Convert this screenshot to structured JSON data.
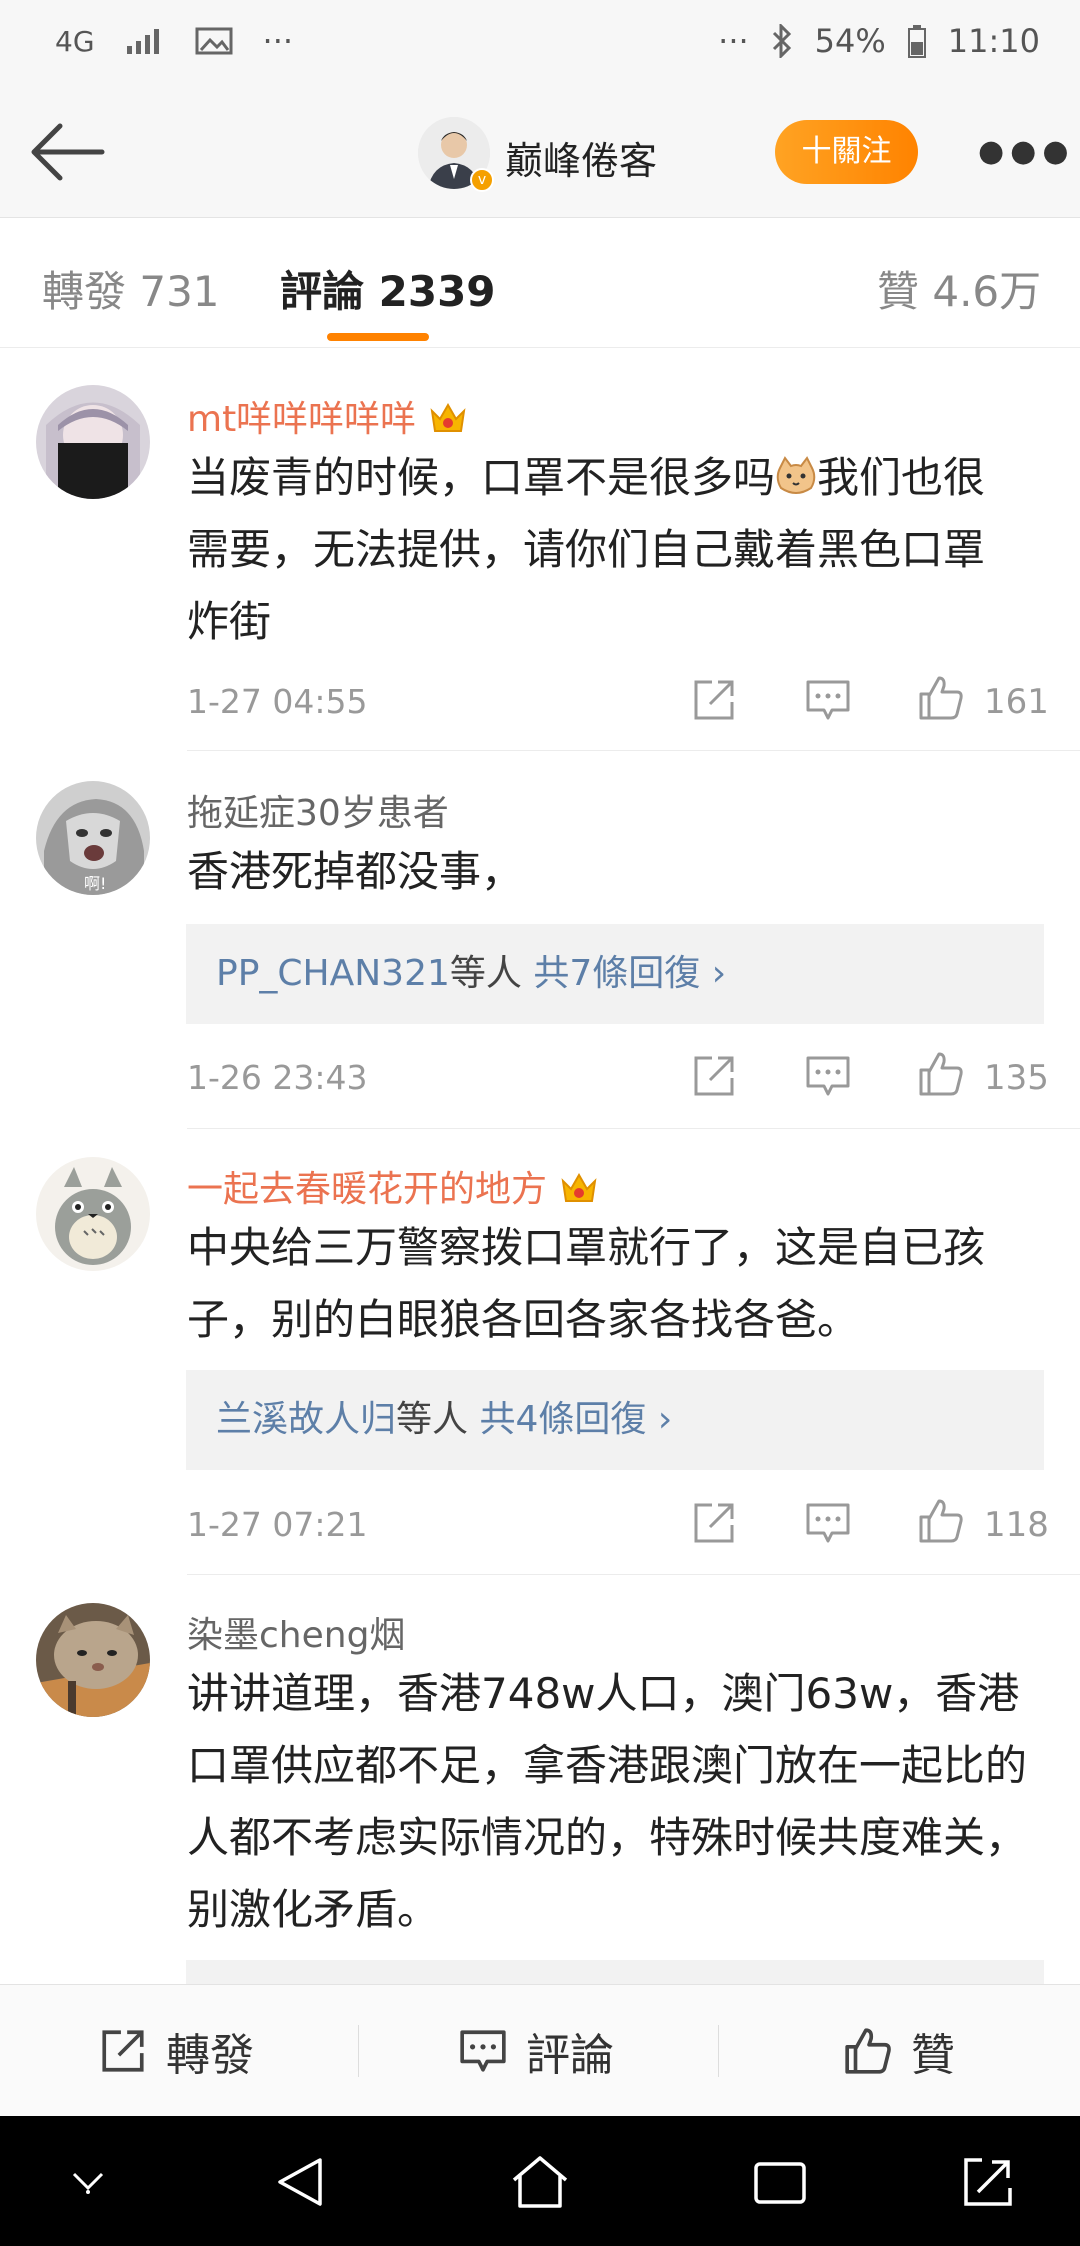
{
  "status": {
    "network": "4G",
    "battery": "54%",
    "time": "11:10"
  },
  "header": {
    "name": "巅峰倦客",
    "follow": "十關注"
  },
  "tabs": {
    "repost": "轉發 731",
    "comments": "評論 2339",
    "likes": "贊 4.6万"
  },
  "comments": [
    {
      "name": "mt咩咩咩咩咩",
      "vip": true,
      "lines": [
        "当废青的时候，口罩不是很多吗",
        "我们也很",
        "需要，无法提供，请你们自己戴着黑色口罩",
        "炸街"
      ],
      "time": "1-27 04:55",
      "likes": "161"
    },
    {
      "name": "拖延症30岁患者",
      "vip": false,
      "text": "香港死掉都没事，",
      "reply_user": "PP_CHAN321",
      "reply_mid": "等人",
      "reply_count": "共7條回復 ›",
      "time": "1-26 23:43",
      "likes": "135"
    },
    {
      "name": "一起去春暖花开的地方",
      "vip": true,
      "text": "中央给三万警察拨口罩就行了，这是自已孩子，别的白眼狼各回各家各找各爸。",
      "reply_user": "兰溪故人归",
      "reply_mid": "等人",
      "reply_count": "共4條回復 ›",
      "time": "1-27 07:21",
      "likes": "118"
    },
    {
      "name": "染墨cheng烟",
      "vip": false,
      "text": "讲讲道理，香港748w人口，澳门63w，香港口罩供应都不足，拿香港跟澳门放在一起比的人都不考虑实际情况的，特殊时候共度难关，别激化矛盾。"
    }
  ],
  "bottom": {
    "repost": "轉發",
    "comment": "評論",
    "like": "贊"
  },
  "icons": [
    "back-icon",
    "share-icon",
    "comment-icon",
    "like-icon",
    "crown-icon",
    "bluetooth-icon",
    "battery-icon",
    "signal-icon",
    "image-icon"
  ],
  "colors": {
    "accent": "#ff8200",
    "vip_name": "#eb7350",
    "link": "#5d7fa8"
  }
}
